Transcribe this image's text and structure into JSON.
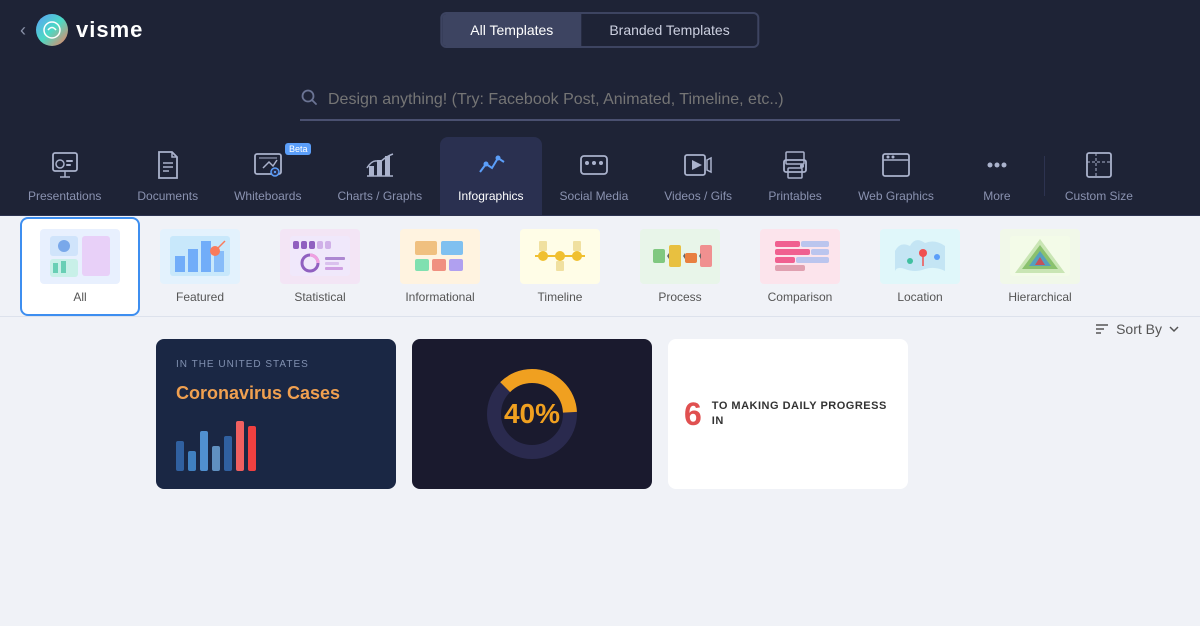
{
  "app": {
    "name": "visme",
    "back_label": "‹"
  },
  "header": {
    "toggle": {
      "all_templates": "All Templates",
      "branded_templates": "Branded Templates"
    },
    "active_toggle": "all_templates"
  },
  "search": {
    "placeholder": "Design anything! (Try: Facebook Post, Animated, Timeline, etc..)"
  },
  "categories": [
    {
      "id": "presentations",
      "label": "Presentations",
      "icon": "▣",
      "beta": false
    },
    {
      "id": "documents",
      "label": "Documents",
      "icon": "📄",
      "beta": false
    },
    {
      "id": "whiteboards",
      "label": "Whiteboards",
      "icon": "✏",
      "beta": true
    },
    {
      "id": "charts",
      "label": "Charts / Graphs",
      "icon": "📊",
      "beta": false
    },
    {
      "id": "infographics",
      "label": "Infographics",
      "icon": "📈",
      "beta": false,
      "active": true
    },
    {
      "id": "social",
      "label": "Social Media",
      "icon": "💬",
      "beta": false
    },
    {
      "id": "videos",
      "label": "Videos / Gifs",
      "icon": "▶",
      "beta": false
    },
    {
      "id": "printables",
      "label": "Printables",
      "icon": "🖨",
      "beta": false
    },
    {
      "id": "web",
      "label": "Web Graphics",
      "icon": "🖼",
      "beta": false
    },
    {
      "id": "more",
      "label": "More",
      "icon": "···",
      "beta": false
    },
    {
      "id": "custom",
      "label": "Custom Size",
      "icon": "⊡",
      "beta": false
    }
  ],
  "sub_categories": [
    {
      "id": "all",
      "label": "All",
      "active": true
    },
    {
      "id": "featured",
      "label": "Featured",
      "active": false
    },
    {
      "id": "statistical",
      "label": "Statistical",
      "active": false
    },
    {
      "id": "informational",
      "label": "Informational",
      "active": false
    },
    {
      "id": "timeline",
      "label": "Timeline",
      "active": false
    },
    {
      "id": "process",
      "label": "Process",
      "active": false
    },
    {
      "id": "comparison",
      "label": "Comparison",
      "active": false
    },
    {
      "id": "location",
      "label": "Location",
      "active": false
    },
    {
      "id": "hierarchical",
      "label": "Hierarchical",
      "active": false
    }
  ],
  "sort": {
    "label": "Sort By",
    "icon": "≡"
  },
  "template_cards": [
    {
      "id": "corona",
      "title": "Coronavirus Cases",
      "subtitle": "IN THE UNITED STATES",
      "bg": "#1a2744",
      "title_color": "#f0a050",
      "sub_color": "#8090b0"
    },
    {
      "id": "percent",
      "title": "40%",
      "bg": "#1a1a2e",
      "percent_color": "#f0a020"
    },
    {
      "id": "progress",
      "title": "TO MAKING DAILY PROGRESS IN",
      "bg": "#ffffff",
      "number": "6"
    }
  ]
}
